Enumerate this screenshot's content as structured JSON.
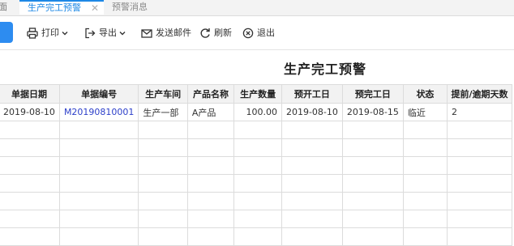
{
  "tabs": {
    "cut_label": "面",
    "active_label": "生产完工预警",
    "close_symbol": "✕",
    "inactive_label": "预警消息"
  },
  "toolbar": {
    "print_label": "打印",
    "export_label": "导出",
    "mail_label": "发送邮件",
    "refresh_label": "刷新",
    "exit_label": "退出"
  },
  "report": {
    "title": "生产完工预警",
    "columns": [
      "单据日期",
      "单据编号",
      "生产车间",
      "产品名称",
      "生产数量",
      "预开工日",
      "预完工日",
      "状态",
      "提前/逾期天数"
    ],
    "rows": [
      [
        "2019-08-10",
        "M20190810001",
        "生产一部",
        "A产品",
        "100.00",
        "2019-08-10",
        "2019-08-15",
        "临近",
        "2"
      ]
    ]
  },
  "colors": {
    "accent": "#1e88e5",
    "link": "#2b3ec9",
    "header_bg": "#f2f2f2"
  },
  "icons": [
    "printer-icon",
    "export-icon",
    "mail-icon",
    "refresh-icon",
    "close-circle-icon",
    "chevron-down-icon"
  ]
}
